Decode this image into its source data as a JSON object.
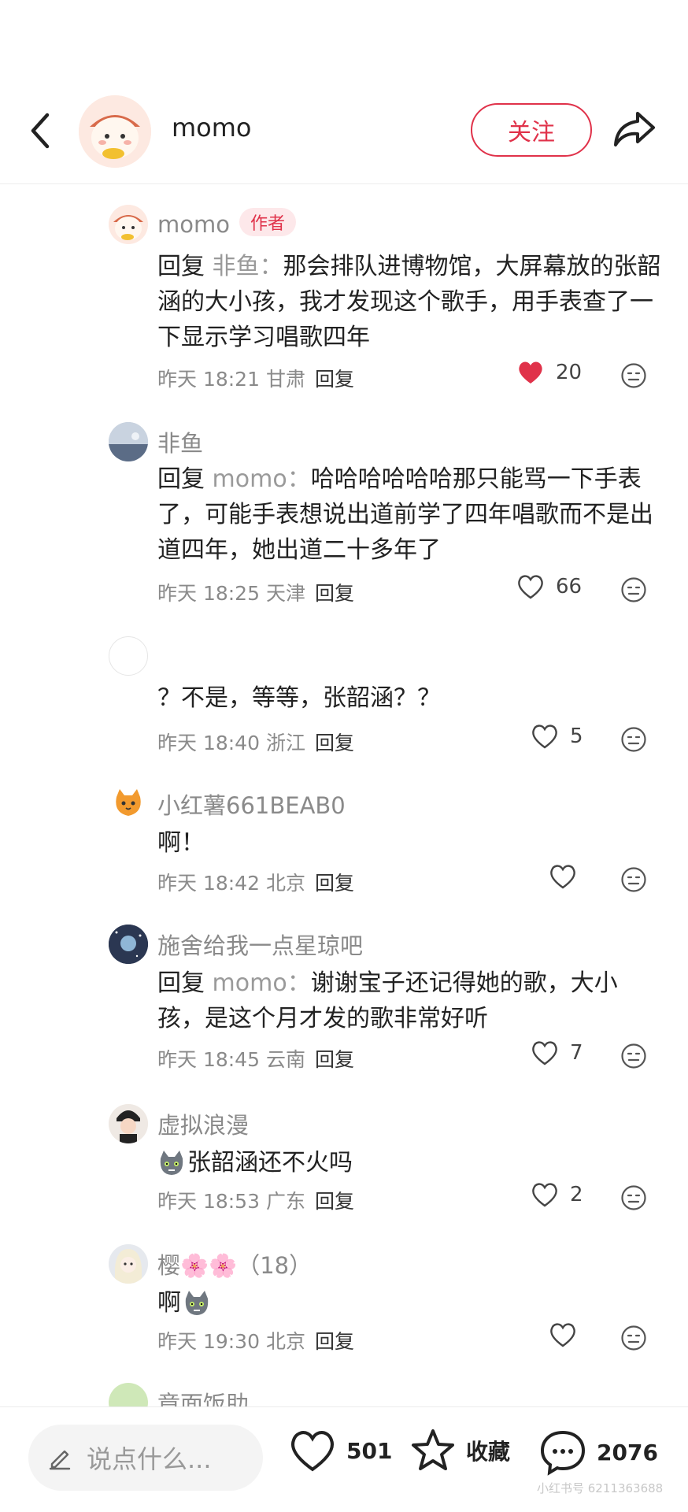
{
  "header": {
    "title": "momo",
    "follow_label": "关注"
  },
  "comments": [
    {
      "name": "momo",
      "badge": "作者",
      "reply_word": "回复",
      "reply_to": "非鱼：",
      "text": "那会排队进博物馆，大屏幕放的张韶涵的大小孩，我才发现这个歌手，用手表查了一下显示学习唱歌四年",
      "time": "昨天 18:21 甘肃",
      "reply_label": "回复",
      "likes": "20",
      "liked": true
    },
    {
      "name": "非鱼",
      "reply_word": "回复",
      "reply_to": "momo：",
      "text": "哈哈哈哈哈哈那只能骂一下手表了，可能手表想说出道前学了四年唱歌而不是出道四年，她出道二十多年了",
      "time": "昨天 18:25 天津",
      "reply_label": "回复",
      "likes": "66",
      "liked": false
    },
    {
      "name": "",
      "text": "？不是，等等，张韶涵？？",
      "time": "昨天 18:40 浙江",
      "reply_label": "回复",
      "likes": "5",
      "liked": false
    },
    {
      "name": "小红薯661BEAB0",
      "text": "啊！",
      "time": "昨天 18:42 北京",
      "reply_label": "回复",
      "likes": "",
      "liked": false
    },
    {
      "name": "施舍给我一点星琼吧",
      "reply_word": "回复",
      "reply_to": "momo：",
      "text": "谢谢宝子还记得她的歌，大小孩，是这个月才发的歌非常好听",
      "time": "昨天 18:45 云南",
      "reply_label": "回复",
      "likes": "7",
      "liked": false
    },
    {
      "name": "虚拟浪漫",
      "text": "张韶涵还不火吗",
      "time": "昨天 18:53 广东",
      "reply_label": "回复",
      "likes": "2",
      "liked": false
    },
    {
      "name": "樱🌸🌸（18）",
      "text": "啊",
      "time": "昨天 19:30 北京",
      "reply_label": "回复",
      "likes": "",
      "liked": false
    },
    {
      "name": "章面饭助"
    }
  ],
  "bottom_bar": {
    "input_placeholder": "说点什么...",
    "likes": "501",
    "collect_label": "收藏",
    "comments": "2076",
    "watermark": "小红书号 6211363688"
  },
  "colors": {
    "accent": "#e0324a",
    "muted_text": "#8a8a8a"
  }
}
